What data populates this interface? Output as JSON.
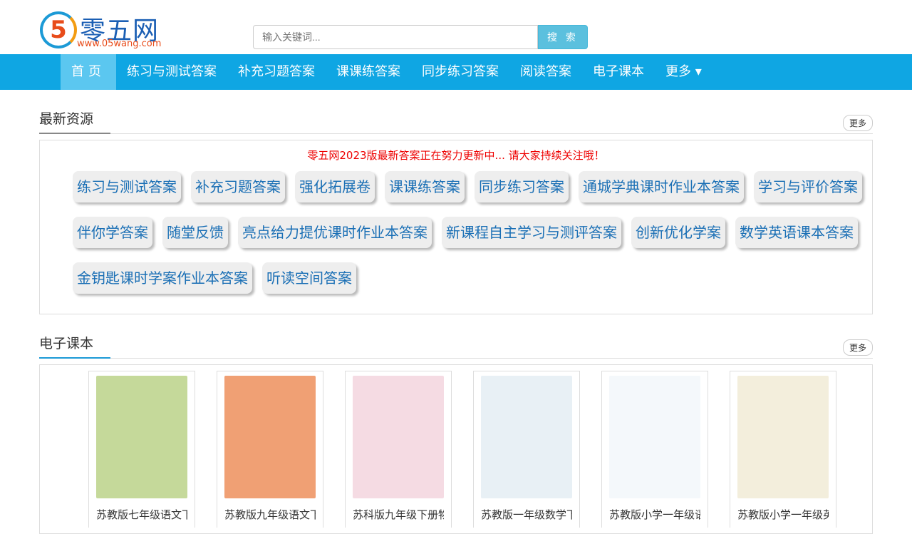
{
  "logo": {
    "text": "零五网",
    "url": "www.05wang.com",
    "digit": "5"
  },
  "search": {
    "placeholder": "输入关键词...",
    "button": "搜 索"
  },
  "nav": [
    {
      "label": "首页"
    },
    {
      "label": "练习与测试答案"
    },
    {
      "label": "补充习题答案"
    },
    {
      "label": "课课练答案"
    },
    {
      "label": "同步练习答案"
    },
    {
      "label": "阅读答案"
    },
    {
      "label": "电子课本"
    },
    {
      "label": "更多 ▾"
    }
  ],
  "latest": {
    "title": "最新资源",
    "more": "更多",
    "notice": "零五网2023版最新答案正在努力更新中... 请大家持续关注哦！",
    "tags": [
      "练习与测试答案",
      "补充习题答案",
      "强化拓展卷",
      "课课练答案",
      "同步练习答案",
      "通城学典课时作业本答案",
      "学习与评价答案",
      "伴你学答案",
      "随堂反馈",
      "亮点给力提优课时作业本答案",
      "新课程自主学习与测评答案",
      "创新优化学案",
      "数学英语课本答案",
      "金钥匙课时学案作业本答案",
      "听读空间答案"
    ]
  },
  "ebooks": {
    "title": "电子课本",
    "more": "更多",
    "items": [
      {
        "title": "苏教版七年级语文下",
        "color": "#c5d99a"
      },
      {
        "title": "苏教版九年级语文下",
        "color": "#f0a074"
      },
      {
        "title": "苏科版九年级下册物",
        "color": "#f5dbe3"
      },
      {
        "title": "苏教版一年级数学下",
        "color": "#e8f0f5"
      },
      {
        "title": "苏教版小学一年级语",
        "color": "#f4f8fb"
      },
      {
        "title": "苏教版小学一年级英",
        "color": "#f3eedc"
      }
    ]
  }
}
